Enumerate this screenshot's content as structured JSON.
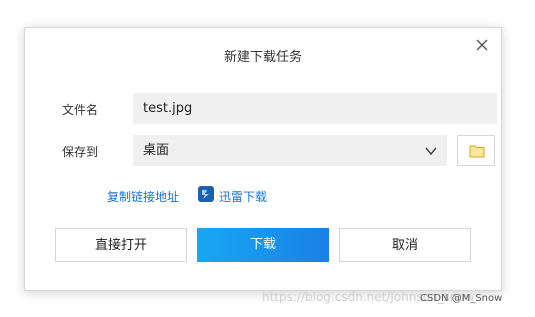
{
  "dialog": {
    "title": "新建下载任务",
    "filename_label": "文件名",
    "filename_value": "test.jpg",
    "saveto_label": "保存到",
    "saveto_value": "桌面",
    "copy_link_label": "复制链接地址",
    "thunder_label": "迅雷下载",
    "open_button": "直接打开",
    "download_button": "下载",
    "cancel_button": "取消"
  },
  "watermark": {
    "url": "https://blog.csdn.net/Johnson_snow",
    "user": "CSDN @M_Snow"
  },
  "icons": {
    "close": "close-icon",
    "chevron": "chevron-down-icon",
    "folder": "folder-icon",
    "thunder": "thunder-icon"
  },
  "colors": {
    "accent_start": "#17a8f3",
    "accent_end": "#1a80e6",
    "link": "#1a73d1",
    "field_bg": "#f0f0f0"
  }
}
